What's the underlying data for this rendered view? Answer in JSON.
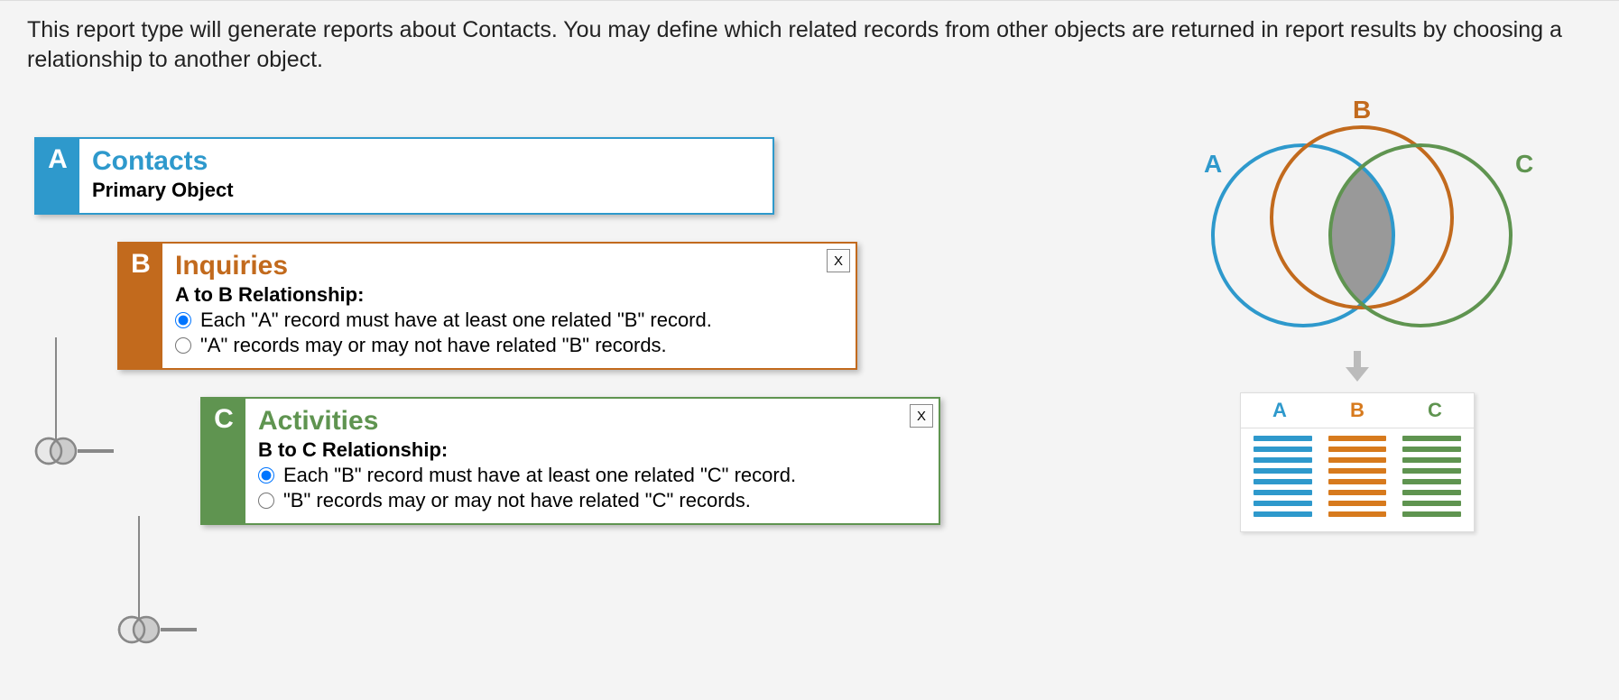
{
  "intro": "This report type will generate reports about Contacts. You may define which related records from other objects are returned in report results by choosing a relationship to another object.",
  "objects": {
    "a": {
      "letter": "A",
      "title": "Contacts",
      "subtitle": "Primary Object"
    },
    "b": {
      "letter": "B",
      "title": "Inquiries",
      "rel_label": "A to B Relationship:",
      "opt1": "Each \"A\" record must have at least one related \"B\" record.",
      "opt2": "\"A\" records may or may not have related \"B\" records.",
      "close": "X"
    },
    "c": {
      "letter": "C",
      "title": "Activities",
      "rel_label": "B to C Relationship:",
      "opt1": "Each \"B\" record must have at least one related \"C\" record.",
      "opt2": "\"B\" records may or may not have related \"C\" records.",
      "close": "X"
    }
  },
  "venn_labels": {
    "a": "A",
    "b": "B",
    "c": "C"
  },
  "table_headers": {
    "a": "A",
    "b": "B",
    "c": "C"
  }
}
